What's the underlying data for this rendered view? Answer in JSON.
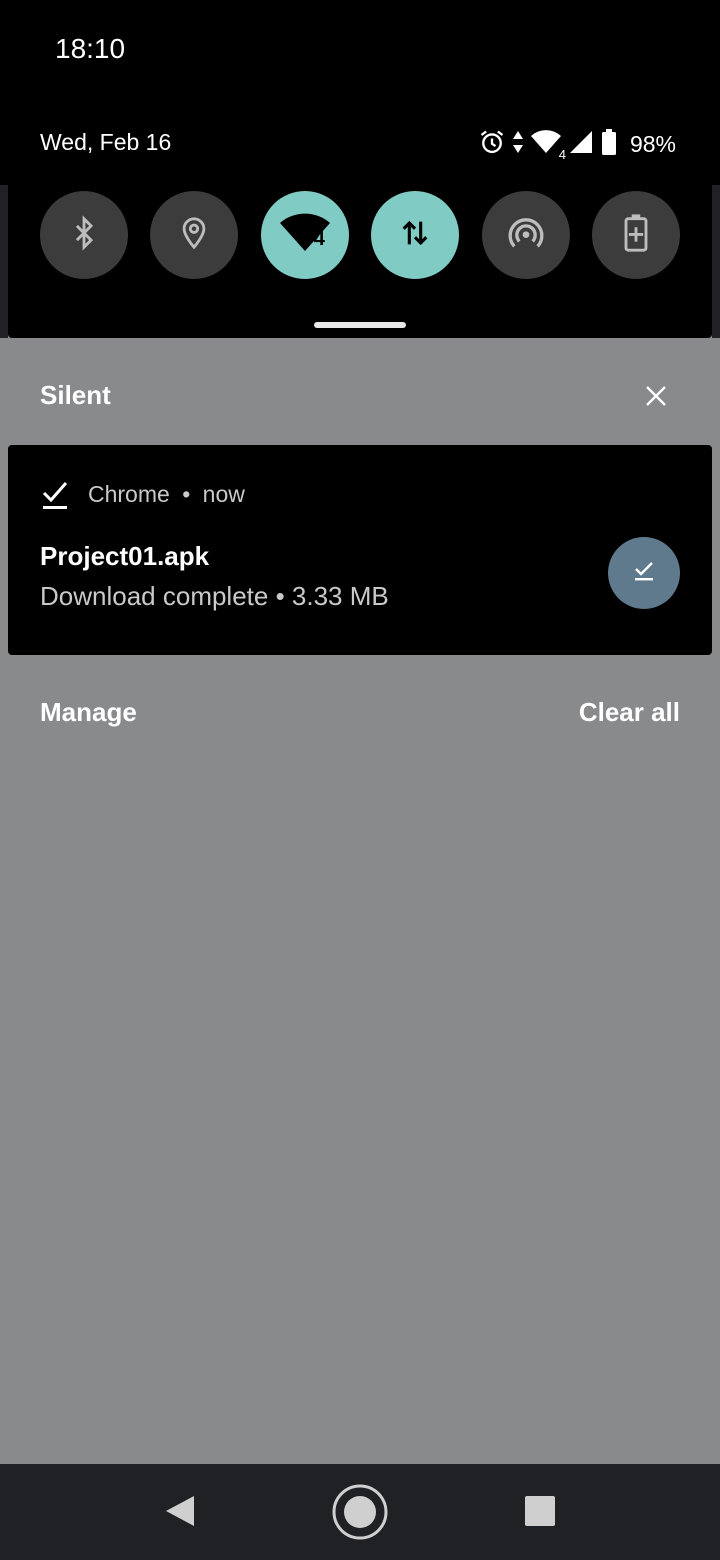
{
  "status_bar": {
    "time": "18:10"
  },
  "quick_settings": {
    "date": "Wed, Feb 16",
    "battery": "98%",
    "network_badge": "4",
    "tiles": [
      {
        "icon": "bluetooth-icon",
        "active": false
      },
      {
        "icon": "location-icon",
        "active": false
      },
      {
        "icon": "wifi-icon",
        "active": true
      },
      {
        "icon": "mobile-data-icon",
        "active": true
      },
      {
        "icon": "hotspot-icon",
        "active": false
      },
      {
        "icon": "battery-saver-icon",
        "active": false
      }
    ],
    "colors": {
      "active_tile": "#80cbc4",
      "inactive_tile": "#3c3c3c"
    }
  },
  "notifications": {
    "section_label": "Silent",
    "items": [
      {
        "app_icon": "download-done-icon",
        "app_name": "Chrome",
        "separator": "•",
        "time": "now",
        "title": "Project01.apk",
        "text": "Download complete • 3.33 MB",
        "action_icon": "download-done-icon",
        "action_color": "#5f7a8c"
      }
    ],
    "manage_label": "Manage",
    "clear_all_label": "Clear all"
  },
  "navigation": {
    "back": "back-icon",
    "home": "home-icon",
    "recents": "recents-icon"
  }
}
